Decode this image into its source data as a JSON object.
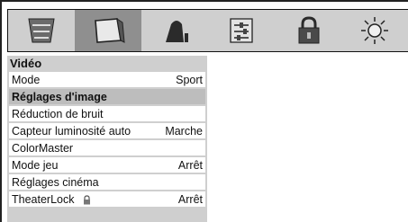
{
  "menu": {
    "title": "Vidéo",
    "items": [
      {
        "label": "Mode",
        "value": "Sport",
        "highlighted": false
      },
      {
        "label": "Réglages d'image",
        "value": "",
        "highlighted": true
      },
      {
        "label": "Réduction de bruit",
        "value": "",
        "highlighted": false
      },
      {
        "label": "Capteur luminosité auto",
        "value": "Marche",
        "highlighted": false
      },
      {
        "label": "ColorMaster",
        "value": "",
        "highlighted": false
      },
      {
        "label": "Mode jeu",
        "value": "Arrêt",
        "highlighted": false
      },
      {
        "label": "Réglages cinéma",
        "value": "",
        "highlighted": false
      },
      {
        "label": "TheaterLock",
        "value": "Arrêt",
        "highlighted": false,
        "icon": "lock-icon"
      }
    ]
  },
  "icon_bar": {
    "icons": [
      "setup-menu-icon",
      "video-picture-icon",
      "audio-speaker-icon",
      "preferences-settings-icon",
      "lock-icon",
      "brightness-sun-icon"
    ],
    "selected_index": 1
  },
  "colors": {
    "panel_gray": "#cfcfcf",
    "selected_gray": "#8f8f8f",
    "highlight_row": "#bdbdbd"
  }
}
